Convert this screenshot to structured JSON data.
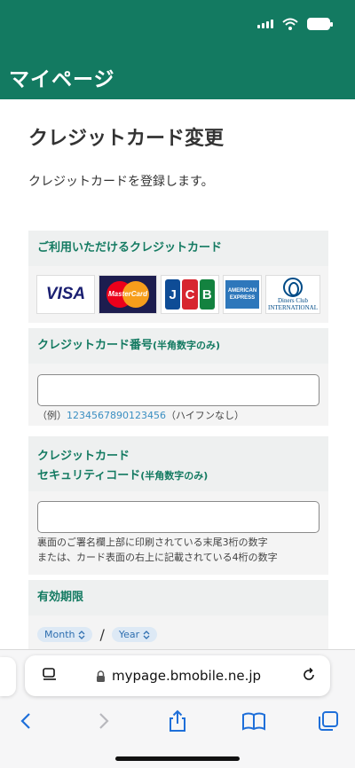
{
  "header": {
    "title": "マイページ"
  },
  "page": {
    "title": "クレジットカード変更",
    "description": "クレジットカードを登録します。"
  },
  "accepted_cards": {
    "label": "ご利用いただけるクレジットカード",
    "cards": [
      {
        "name": "VISA",
        "icon": "visa-logo"
      },
      {
        "name": "MasterCard",
        "icon": "mastercard-logo"
      },
      {
        "name": "JCB",
        "icon": "jcb-logo"
      },
      {
        "name": "AMERICAN EXPRESS",
        "icon": "amex-logo"
      },
      {
        "name": "Diners Club INTERNATIONAL",
        "icon": "diners-logo"
      }
    ]
  },
  "card_number": {
    "label": "クレジットカード番号",
    "note": "(半角数字のみ)",
    "value": "",
    "hint_prefix": "（例）",
    "hint_example": "1234567890123456",
    "hint_suffix": "（ハイフンなし）"
  },
  "security_code": {
    "label_line1": "クレジットカード",
    "label_line2": "セキュリティコード",
    "note": "(半角数字のみ)",
    "value": "",
    "hint_line1": "裏面のご署名欄上部に印刷されている末尾3桁の数字",
    "hint_line2": "または、カード表面の右上に記載されている4桁の数字"
  },
  "expiry": {
    "label": "有効期限",
    "month": "Month",
    "separator": "/",
    "year": "Year"
  },
  "browser": {
    "url": "mypage.bmobile.ne.jp"
  },
  "colors": {
    "brand": "#137a61",
    "link": "#3b8fc2"
  }
}
